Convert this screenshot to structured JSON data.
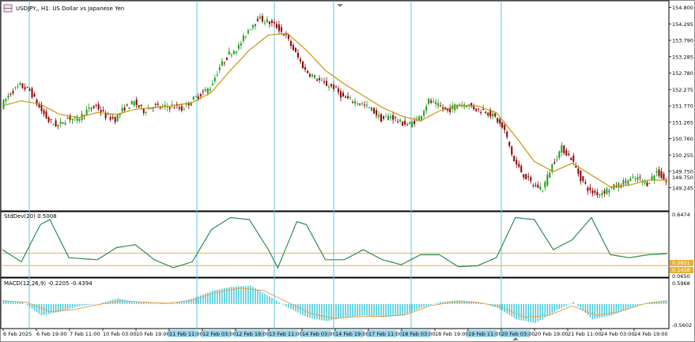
{
  "window": {
    "title": "USDJPY,, H1:  US Dollar vs Japanese Yen",
    "icon": "chart-window-icon"
  },
  "indicators": {
    "stddev_label": "StdDev(20) 0.5008",
    "macd_label": "MACD(12,26,9) -0.2205 -0.4394"
  },
  "price_axis": {
    "ticks": [
      "154.800",
      "154.295",
      "153.790",
      "153.285",
      "152.780",
      "152.275",
      "151.770",
      "151.265",
      "150.760",
      "150.255",
      "149.750",
      "149.245"
    ],
    "current_price": "149.750"
  },
  "stddev_axis": {
    "top": "0.6474",
    "bottom": "0.0650",
    "level1": "0.2651",
    "level2": "0.1418"
  },
  "macd_axis": {
    "top": "0.5968",
    "bottom": "-0.5602"
  },
  "time_axis": {
    "labels": [
      "6 Feb 2025",
      "6 Feb 19:00",
      "7 Feb 11:00",
      "10 Feb 03:00",
      "10 Feb 19:00",
      "11 Feb 11:00",
      "12 Feb 03:00",
      "12 Feb 19:00",
      "13 Feb 11:00",
      "14 Feb 03:00",
      "14 Feb 19:00",
      "17 Feb 11:00",
      "18 Feb 03:00",
      "18 Feb 19:00",
      "19 Feb 11:00",
      "20 Feb 03:00",
      "20 Feb 19:00",
      "21 Feb 11:00",
      "24 Feb 03:00",
      "24 Feb 19:00"
    ],
    "highlighted_indices": [
      5,
      6,
      7,
      8,
      9,
      10,
      11,
      12,
      14,
      15
    ]
  },
  "colors": {
    "bull": "#1e9c1e",
    "bear": "#8b0000",
    "ma": "#c8960a",
    "stddev": "#2e8b57",
    "macd_hist": "#40c8d8",
    "macd_signal": "#e8a050",
    "vline": "#5bc8e8",
    "level": "#e8b030",
    "label_bg": "#49b3df"
  },
  "chart_data": {
    "type": "candlestick",
    "symbol": "USDJPY",
    "timeframe": "H1",
    "ylim": [
      149.0,
      154.9
    ],
    "price_path": [
      [
        0,
        151.95
      ],
      [
        4,
        152.35
      ],
      [
        8,
        152.55
      ],
      [
        12,
        152.4
      ],
      [
        16,
        151.9
      ],
      [
        20,
        151.5
      ],
      [
        24,
        151.35
      ],
      [
        28,
        151.6
      ],
      [
        32,
        151.55
      ],
      [
        36,
        151.8
      ],
      [
        40,
        151.95
      ],
      [
        44,
        151.65
      ],
      [
        48,
        151.55
      ],
      [
        52,
        151.9
      ],
      [
        56,
        152.05
      ],
      [
        60,
        151.8
      ],
      [
        64,
        151.95
      ],
      [
        68,
        151.9
      ],
      [
        72,
        151.95
      ],
      [
        76,
        151.85
      ],
      [
        80,
        152.1
      ],
      [
        84,
        152.3
      ],
      [
        88,
        152.5
      ],
      [
        92,
        153.1
      ],
      [
        96,
        153.5
      ],
      [
        100,
        153.7
      ],
      [
        104,
        154.2
      ],
      [
        108,
        154.55
      ],
      [
        112,
        154.45
      ],
      [
        116,
        154.3
      ],
      [
        120,
        154.0
      ],
      [
        124,
        153.5
      ],
      [
        128,
        153.0
      ],
      [
        132,
        152.8
      ],
      [
        136,
        152.6
      ],
      [
        140,
        152.5
      ],
      [
        144,
        152.2
      ],
      [
        148,
        152.1
      ],
      [
        152,
        152.0
      ],
      [
        156,
        151.85
      ],
      [
        160,
        151.55
      ],
      [
        164,
        151.65
      ],
      [
        168,
        151.45
      ],
      [
        172,
        151.4
      ],
      [
        176,
        151.6
      ],
      [
        180,
        152.1
      ],
      [
        184,
        151.95
      ],
      [
        188,
        151.8
      ],
      [
        192,
        152.0
      ],
      [
        196,
        152.0
      ],
      [
        200,
        151.85
      ],
      [
        204,
        151.8
      ],
      [
        208,
        151.6
      ],
      [
        212,
        151.2
      ],
      [
        216,
        150.3
      ],
      [
        220,
        149.9
      ],
      [
        224,
        149.6
      ],
      [
        228,
        149.5
      ],
      [
        232,
        150.2
      ],
      [
        236,
        150.7
      ],
      [
        240,
        150.4
      ],
      [
        244,
        149.8
      ],
      [
        248,
        149.4
      ],
      [
        252,
        149.35
      ],
      [
        256,
        149.5
      ],
      [
        260,
        149.6
      ],
      [
        264,
        149.75
      ],
      [
        268,
        149.8
      ],
      [
        272,
        149.65
      ],
      [
        276,
        150.0
      ],
      [
        280,
        149.7
      ]
    ],
    "ma_path": [
      [
        0,
        151.95
      ],
      [
        8,
        152.1
      ],
      [
        16,
        152.0
      ],
      [
        24,
        151.7
      ],
      [
        32,
        151.6
      ],
      [
        40,
        151.75
      ],
      [
        48,
        151.7
      ],
      [
        56,
        151.85
      ],
      [
        64,
        151.9
      ],
      [
        72,
        151.95
      ],
      [
        80,
        152.05
      ],
      [
        88,
        152.35
      ],
      [
        96,
        153.0
      ],
      [
        104,
        153.6
      ],
      [
        112,
        154.05
      ],
      [
        120,
        154.1
      ],
      [
        128,
        153.6
      ],
      [
        136,
        153.0
      ],
      [
        144,
        152.6
      ],
      [
        152,
        152.25
      ],
      [
        160,
        151.9
      ],
      [
        168,
        151.65
      ],
      [
        176,
        151.5
      ],
      [
        184,
        151.8
      ],
      [
        192,
        151.95
      ],
      [
        200,
        151.95
      ],
      [
        208,
        151.75
      ],
      [
        216,
        151.05
      ],
      [
        224,
        150.3
      ],
      [
        232,
        150.0
      ],
      [
        240,
        150.25
      ],
      [
        248,
        149.9
      ],
      [
        256,
        149.55
      ],
      [
        264,
        149.6
      ],
      [
        272,
        149.75
      ],
      [
        280,
        149.75
      ]
    ],
    "stddev_path": [
      [
        0,
        0.3
      ],
      [
        8,
        0.18
      ],
      [
        16,
        0.55
      ],
      [
        20,
        0.6
      ],
      [
        28,
        0.22
      ],
      [
        40,
        0.2
      ],
      [
        48,
        0.32
      ],
      [
        56,
        0.35
      ],
      [
        64,
        0.2
      ],
      [
        72,
        0.12
      ],
      [
        80,
        0.18
      ],
      [
        88,
        0.5
      ],
      [
        96,
        0.62
      ],
      [
        104,
        0.6
      ],
      [
        112,
        0.3
      ],
      [
        116,
        0.12
      ],
      [
        124,
        0.58
      ],
      [
        128,
        0.55
      ],
      [
        136,
        0.2
      ],
      [
        144,
        0.2
      ],
      [
        152,
        0.3
      ],
      [
        160,
        0.2
      ],
      [
        168,
        0.15
      ],
      [
        176,
        0.25
      ],
      [
        184,
        0.25
      ],
      [
        192,
        0.13
      ],
      [
        200,
        0.14
      ],
      [
        208,
        0.22
      ],
      [
        216,
        0.62
      ],
      [
        224,
        0.6
      ],
      [
        232,
        0.3
      ],
      [
        240,
        0.4
      ],
      [
        248,
        0.62
      ],
      [
        256,
        0.25
      ],
      [
        264,
        0.22
      ],
      [
        272,
        0.25
      ],
      [
        280,
        0.26
      ]
    ],
    "stddev_ylim": [
      0.065,
      0.6474
    ],
    "stddev_levels": [
      0.2651,
      0.1418
    ],
    "macd_hist_path": [
      [
        0,
        0.1
      ],
      [
        8,
        0.05
      ],
      [
        16,
        -0.3
      ],
      [
        24,
        -0.2
      ],
      [
        32,
        -0.05
      ],
      [
        40,
        0.0
      ],
      [
        48,
        0.15
      ],
      [
        56,
        0.05
      ],
      [
        64,
        0.02
      ],
      [
        72,
        0.02
      ],
      [
        80,
        0.15
      ],
      [
        88,
        0.35
      ],
      [
        96,
        0.45
      ],
      [
        104,
        0.48
      ],
      [
        112,
        0.2
      ],
      [
        120,
        -0.1
      ],
      [
        128,
        -0.35
      ],
      [
        136,
        -0.45
      ],
      [
        144,
        -0.35
      ],
      [
        152,
        -0.3
      ],
      [
        160,
        -0.35
      ],
      [
        168,
        -0.3
      ],
      [
        176,
        -0.1
      ],
      [
        184,
        0.05
      ],
      [
        192,
        0.1
      ],
      [
        200,
        0.05
      ],
      [
        208,
        -0.1
      ],
      [
        216,
        -0.4
      ],
      [
        224,
        -0.5
      ],
      [
        232,
        -0.2
      ],
      [
        240,
        0.05
      ],
      [
        248,
        -0.4
      ],
      [
        256,
        -0.3
      ],
      [
        264,
        -0.1
      ],
      [
        272,
        0.05
      ],
      [
        280,
        0.1
      ]
    ],
    "macd_signal_path": [
      [
        0,
        0.08
      ],
      [
        10,
        0.05
      ],
      [
        20,
        -0.2
      ],
      [
        30,
        -0.15
      ],
      [
        40,
        -0.02
      ],
      [
        50,
        0.08
      ],
      [
        60,
        0.05
      ],
      [
        70,
        0.02
      ],
      [
        80,
        0.1
      ],
      [
        90,
        0.3
      ],
      [
        100,
        0.42
      ],
      [
        110,
        0.35
      ],
      [
        120,
        0.05
      ],
      [
        130,
        -0.25
      ],
      [
        140,
        -0.38
      ],
      [
        150,
        -0.33
      ],
      [
        160,
        -0.32
      ],
      [
        170,
        -0.28
      ],
      [
        180,
        -0.05
      ],
      [
        190,
        0.06
      ],
      [
        200,
        0.05
      ],
      [
        210,
        -0.08
      ],
      [
        220,
        -0.35
      ],
      [
        230,
        -0.3
      ],
      [
        240,
        -0.05
      ],
      [
        250,
        -0.3
      ],
      [
        260,
        -0.2
      ],
      [
        270,
        0.0
      ],
      [
        280,
        0.08
      ]
    ],
    "macd_ylim": [
      -0.5602,
      0.5968
    ]
  }
}
